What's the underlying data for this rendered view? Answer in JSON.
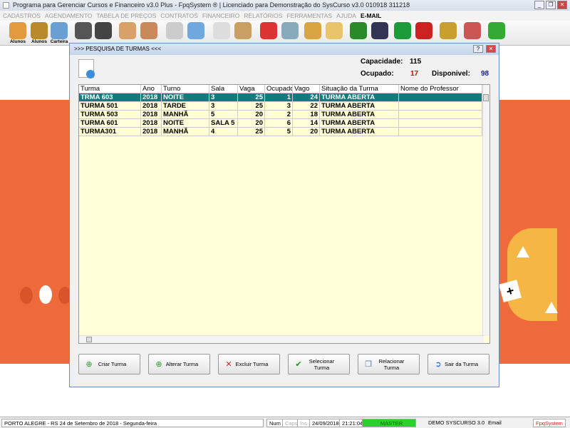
{
  "window": {
    "title": "Programa para Gerenciar Cursos e Financeiro v3.0 Plus - FpqSystem ® | Licenciado para  Demonstração do SysCurso v3.0 010918 311218"
  },
  "menu": [
    "CADASTROS",
    "AGENDAMENTO",
    "TABELA DE PREÇOS",
    "CONTRATOS",
    "FINANCEIRO",
    "RELATÓRIOS",
    "FERRAMENTAS",
    "AJUDA"
  ],
  "menu_email": "E-MAIL",
  "toolbar": [
    {
      "icon": "students-icon",
      "label": "Alunos",
      "color": "#e39a3c"
    },
    {
      "icon": "coin-icon",
      "label": "Alunos",
      "color": "#b88a2a"
    },
    {
      "icon": "id-card-icon",
      "label": "Carteira",
      "color": "#6a9fd4"
    },
    {
      "icon": "badge-icon",
      "label": "",
      "color": "#555"
    },
    {
      "icon": "monitor-icon",
      "label": "",
      "color": "#444"
    },
    {
      "icon": "people-icon",
      "label": "",
      "color": "#d9a06a"
    },
    {
      "icon": "person-icon",
      "label": "",
      "color": "#c88a5a"
    },
    {
      "icon": "calendar-icon",
      "label": "",
      "color": "#ccc"
    },
    {
      "icon": "printer-icon",
      "label": "",
      "color": "#6fa8dc"
    },
    {
      "icon": "document-icon",
      "label": "",
      "color": "#ddd"
    },
    {
      "icon": "scroll-icon",
      "label": "",
      "color": "#c9a064"
    },
    {
      "icon": "pen-icon",
      "label": "",
      "color": "#d33"
    },
    {
      "icon": "search-doc-icon",
      "label": "",
      "color": "#8ab"
    },
    {
      "icon": "archive-icon",
      "label": "",
      "color": "#d9a441"
    },
    {
      "icon": "mail-icon",
      "label": "",
      "color": "#e9c46a"
    },
    {
      "icon": "money-chart-icon",
      "label": "",
      "color": "#2a8a2a"
    },
    {
      "icon": "books-icon",
      "label": "",
      "color": "#335"
    },
    {
      "icon": "dollar-green-icon",
      "label": "",
      "color": "#1d9a3a"
    },
    {
      "icon": "dollar-red-icon",
      "label": "",
      "color": "#c22"
    },
    {
      "icon": "coins-icon",
      "label": "",
      "color": "#c9a030"
    },
    {
      "icon": "support-icon",
      "label": "",
      "color": "#c55"
    },
    {
      "icon": "exit-icon",
      "label": "",
      "color": "#3a3"
    }
  ],
  "dialog": {
    "title": ">>> PESQUISA DE TURMAS <<<",
    "capacidade_label": "Capacidade:",
    "capacidade": "115",
    "ocupado_label": "Ocupado:",
    "ocupado": "17",
    "disponivel_label": "Disponivel:",
    "disponivel": "98",
    "colors": {
      "ocupado": "#e00000",
      "disponivel": "#1a1a9a",
      "selected_row": "#0f7d7d"
    },
    "columns": [
      "Turma",
      "Ano",
      "Turno",
      "Sala",
      "Vaga",
      "Ocupado",
      "Vago",
      "Situação da Turma",
      "Nome do Professor"
    ],
    "rows": [
      [
        "TRMA 603",
        "2018",
        "NOITE",
        "3",
        "25",
        "1",
        "24",
        "TURMA ABERTA",
        ""
      ],
      [
        "TURMA 501",
        "2018",
        "TARDE",
        "3",
        "25",
        "3",
        "22",
        "TURMA ABERTA",
        ""
      ],
      [
        "TURMA 503",
        "2018",
        "MANHÃ",
        "5",
        "20",
        "2",
        "18",
        "TURMA ABERTA",
        ""
      ],
      [
        "TURMA 601",
        "2018",
        "NOITE",
        "SALA 5",
        "20",
        "6",
        "14",
        "TURMA ABERTA",
        ""
      ],
      [
        "TURMA301",
        "2018",
        "MANHÃ",
        "4",
        "25",
        "5",
        "20",
        "TURMA ABERTA",
        ""
      ]
    ],
    "selected_row": 0,
    "buttons": [
      {
        "name": "criar-turma-button",
        "icon": "add-doc-icon",
        "glyph": "⊕",
        "color": "#2a9a2a",
        "label": "Criar Turma"
      },
      {
        "name": "alterar-turma-button",
        "icon": "edit-doc-icon",
        "glyph": "⊕",
        "color": "#2a9a2a",
        "label": "Alterar Turma"
      },
      {
        "name": "excluir-turma-button",
        "icon": "delete-doc-icon",
        "glyph": "✕",
        "color": "#d22",
        "label": "Excluir Turma"
      },
      {
        "name": "selecionar-turma-button",
        "icon": "check-icon",
        "glyph": "✔",
        "color": "#1a9a1a",
        "label": "Selecionar Turma"
      },
      {
        "name": "relacionar-turma-button",
        "icon": "relate-doc-icon",
        "glyph": "❐",
        "color": "#57a",
        "label": "Relacionar Turma"
      },
      {
        "name": "sair-turma-button",
        "icon": "exit-arrow-icon",
        "glyph": "➲",
        "color": "#2a6ad0",
        "label": "Sair da Turma"
      }
    ]
  },
  "status": {
    "location": "PORTO ALEGRE - RS 24 de Setembro de 2018 - Segunda-feira",
    "num": "Num",
    "caps": "Caps",
    "ins": "Ins",
    "date": "24/09/2018",
    "time": "21:21:04",
    "user": "MASTER",
    "db": "DEMO SYSCURSO 3.0",
    "email": "Email",
    "brand": "FpqSystem"
  }
}
